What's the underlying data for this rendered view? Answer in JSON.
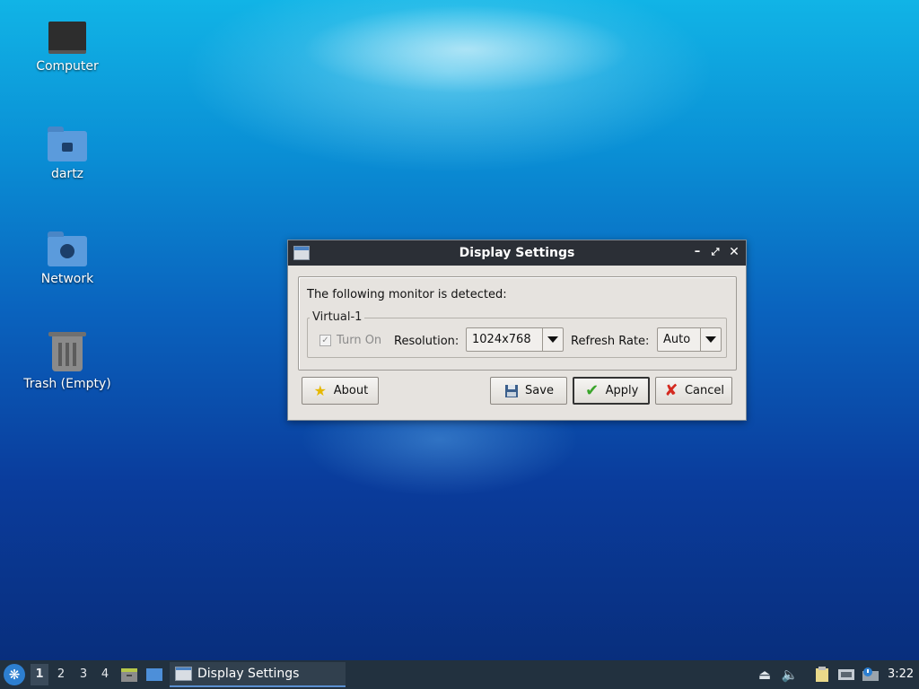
{
  "desktop": {
    "icons": [
      {
        "label": "Computer",
        "icon": "computer-icon"
      },
      {
        "label": "dartz",
        "icon": "home-folder-icon"
      },
      {
        "label": "Network",
        "icon": "network-folder-icon"
      },
      {
        "label": "Trash (Empty)",
        "icon": "trash-icon"
      }
    ]
  },
  "window": {
    "title": "Display Settings",
    "detected_text": "The following monitor is detected:",
    "monitor_name": "Virtual-1",
    "turn_on_label": "Turn On",
    "turn_on_checked": true,
    "turn_on_enabled": false,
    "resolution_label": "Resolution:",
    "resolution_value": "1024x768",
    "refresh_label": "Refresh Rate:",
    "refresh_value": "Auto",
    "buttons": {
      "about": "About",
      "save": "Save",
      "apply": "Apply",
      "cancel": "Cancel"
    }
  },
  "taskbar": {
    "workspaces": [
      "1",
      "2",
      "3",
      "4"
    ],
    "active_workspace": "1",
    "task_title": "Display Settings",
    "clock": "3:22"
  },
  "colors": {
    "taskbar_bg": "#22313f",
    "titlebar_bg": "#2b2f36",
    "dialog_bg": "#e6e3df"
  }
}
